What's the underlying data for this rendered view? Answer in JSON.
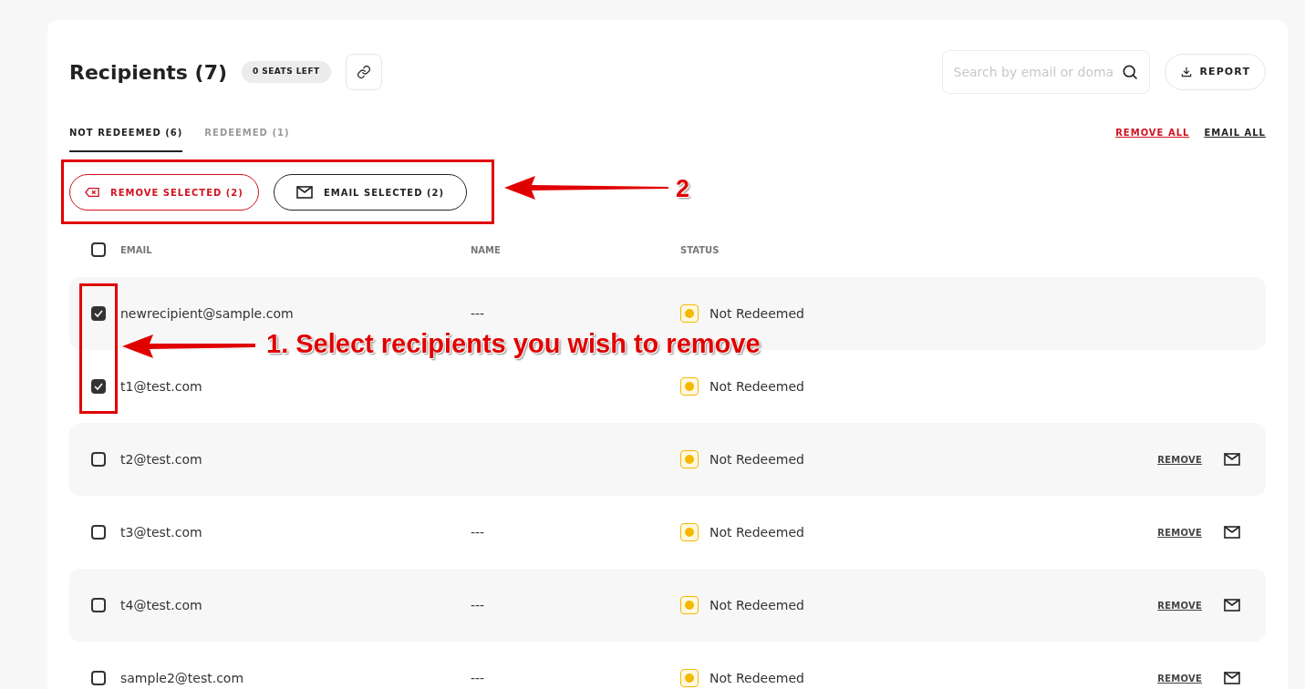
{
  "header": {
    "title": "Recipients (7)",
    "seats_badge": "0 SEATS LEFT",
    "search": {
      "placeholder": "Search by email or doma"
    },
    "report_button": "REPORT"
  },
  "tabs": [
    {
      "label": "NOT REDEEMED (6)",
      "selected": true
    },
    {
      "label": "REDEEMED (1)",
      "selected": false
    }
  ],
  "bulk_links": {
    "remove_all": "REMOVE ALL",
    "email_all": "EMAIL ALL"
  },
  "selection_buttons": {
    "remove": "REMOVE SELECTED (2)",
    "email": "EMAIL SELECTED (2)"
  },
  "table": {
    "select_all": {
      "checked": false
    },
    "columns": [
      "EMAIL",
      "NAME",
      "STATUS"
    ],
    "rows": [
      {
        "email": "newrecipient@sample.com",
        "name": "---",
        "status": "Not Redeemed",
        "checked": true
      },
      {
        "email": "t1@test.com",
        "status": "Not Redeemed",
        "checked": true
      },
      {
        "email": "t2@test.com",
        "status": "Not Redeemed",
        "checked": false,
        "remove_label": "REMOVE",
        "email_action": true
      },
      {
        "email": "t3@test.com",
        "name": "---",
        "status": "Not Redeemed",
        "checked": false,
        "remove_label": "REMOVE",
        "email_action": true
      },
      {
        "email": "t4@test.com",
        "name": "---",
        "status": "Not Redeemed",
        "checked": false,
        "remove_label": "REMOVE",
        "email_action": true
      },
      {
        "email": "sample2@test.com",
        "name": "---",
        "status": "Not Redeemed",
        "checked": false,
        "remove_label": "REMOVE",
        "email_action": true
      }
    ]
  },
  "annotations": [
    {
      "kind": "step",
      "text": "1. Select recipients you wish to remove"
    },
    {
      "kind": "step",
      "text": "2"
    }
  ]
}
